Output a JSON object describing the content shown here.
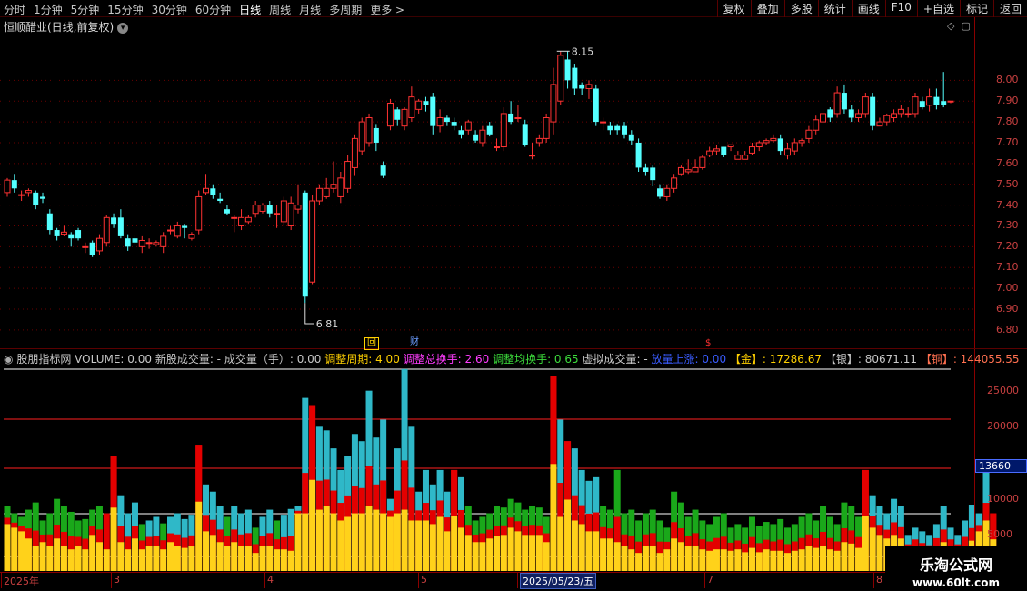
{
  "toolbar": {
    "periods": [
      "分时",
      "1分钟",
      "5分钟",
      "15分钟",
      "30分钟",
      "60分钟",
      "日线",
      "周线",
      "月线",
      "多周期",
      "更多 >"
    ],
    "active": "日线",
    "right": [
      "复权",
      "叠加",
      "多股",
      "统计",
      "画线",
      "F10",
      "+自选",
      "标记",
      "返回"
    ]
  },
  "title": "恒顺醋业(日线,前复权)",
  "price_axis": [
    "8.00",
    "7.90",
    "7.80",
    "7.70",
    "7.60",
    "7.50",
    "7.40",
    "7.30",
    "7.20",
    "7.10",
    "7.00",
    "6.90",
    "6.80"
  ],
  "high_label": "8.15",
  "low_label": "6.81",
  "events": {
    "hui": "回",
    "cai": "财",
    "dollar": "$"
  },
  "indicator": {
    "name": "股朋指标网",
    "volume": "VOLUME: 0.00",
    "new_vol": "新股成交量: -",
    "vol_hand": "成交量（手）: 0.00",
    "period": "调整周期: 4.00",
    "total_turn": "调整总换手: 2.60",
    "avg_turn": "调整均换手: 0.65",
    "virt": "虚拟成交量: -",
    "up": "放量上涨: 0.00",
    "gold": "【金】: 17286.67",
    "silver": "【银】: 80671.11",
    "copper": "【铜】: 144055.55"
  },
  "vol_axis": [
    "25000",
    "20000",
    "10000",
    "5000"
  ],
  "vol_highlight": "13660",
  "dates": [
    "2025年",
    "3",
    "4",
    "5",
    "2025/05/23/五",
    "7",
    "8"
  ],
  "watermark": {
    "line1": "乐淘公式网",
    "line2": "www.60lt.com"
  },
  "chart_data": {
    "type": "candlestick",
    "ylim": [
      6.76,
      8.22
    ],
    "candles": [
      [
        7.46,
        7.52,
        7.44,
        7.53
      ],
      [
        7.52,
        7.48,
        7.46,
        7.55
      ],
      [
        7.45,
        7.45,
        7.42,
        7.47
      ],
      [
        7.46,
        7.47,
        7.44,
        7.48
      ],
      [
        7.46,
        7.4,
        7.38,
        7.47
      ],
      [
        7.44,
        7.43,
        7.41,
        7.46
      ],
      [
        7.36,
        7.28,
        7.26,
        7.38
      ],
      [
        7.28,
        7.25,
        7.23,
        7.29
      ],
      [
        7.26,
        7.27,
        7.25,
        7.3
      ],
      [
        7.26,
        7.24,
        7.2,
        7.27
      ],
      [
        7.28,
        7.24,
        7.23,
        7.29
      ],
      [
        7.2,
        7.2,
        7.17,
        7.22
      ],
      [
        7.22,
        7.16,
        7.15,
        7.23
      ],
      [
        7.18,
        7.24,
        7.16,
        7.26
      ],
      [
        7.22,
        7.34,
        7.2,
        7.35
      ],
      [
        7.34,
        7.31,
        7.29,
        7.36
      ],
      [
        7.34,
        7.25,
        7.24,
        7.38
      ],
      [
        7.24,
        7.2,
        7.18,
        7.26
      ],
      [
        7.24,
        7.22,
        7.21,
        7.26
      ],
      [
        7.2,
        7.23,
        7.17,
        7.25
      ],
      [
        7.22,
        7.22,
        7.19,
        7.24
      ],
      [
        7.21,
        7.22,
        7.2,
        7.23
      ],
      [
        7.2,
        7.25,
        7.17,
        7.27
      ],
      [
        7.28,
        7.28,
        7.26,
        7.3
      ],
      [
        7.25,
        7.3,
        7.24,
        7.32
      ],
      [
        7.3,
        7.29,
        7.24,
        7.31
      ],
      [
        7.24,
        7.26,
        7.23,
        7.27
      ],
      [
        7.28,
        7.44,
        7.26,
        7.47
      ],
      [
        7.46,
        7.48,
        7.45,
        7.55
      ],
      [
        7.48,
        7.45,
        7.43,
        7.5
      ],
      [
        7.43,
        7.42,
        7.41,
        7.46
      ],
      [
        7.38,
        7.36,
        7.35,
        7.4
      ],
      [
        7.34,
        7.34,
        7.27,
        7.35
      ],
      [
        7.3,
        7.34,
        7.28,
        7.38
      ],
      [
        7.32,
        7.34,
        7.31,
        7.35
      ],
      [
        7.36,
        7.4,
        7.34,
        7.42
      ],
      [
        7.37,
        7.4,
        7.36,
        7.41
      ],
      [
        7.4,
        7.36,
        7.34,
        7.42
      ],
      [
        7.36,
        7.36,
        7.29,
        7.4
      ],
      [
        7.32,
        7.42,
        7.3,
        7.44
      ],
      [
        7.3,
        7.41,
        7.28,
        7.44
      ],
      [
        7.38,
        7.4,
        7.36,
        7.5
      ],
      [
        7.46,
        6.96,
        6.93,
        7.47
      ],
      [
        7.03,
        7.42,
        7.02,
        7.45
      ],
      [
        7.42,
        7.48,
        7.4,
        7.5
      ],
      [
        7.44,
        7.48,
        7.43,
        7.53
      ],
      [
        7.48,
        7.5,
        7.46,
        7.61
      ],
      [
        7.44,
        7.53,
        7.41,
        7.56
      ],
      [
        7.48,
        7.61,
        7.46,
        7.64
      ],
      [
        7.58,
        7.72,
        7.54,
        7.74
      ],
      [
        7.66,
        7.8,
        7.64,
        7.82
      ],
      [
        7.7,
        7.82,
        7.68,
        7.84
      ],
      [
        7.77,
        7.7,
        7.66,
        7.79
      ],
      [
        7.59,
        7.54,
        7.53,
        7.61
      ],
      [
        7.78,
        7.89,
        7.76,
        7.91
      ],
      [
        7.86,
        7.81,
        7.78,
        7.87
      ],
      [
        7.78,
        7.86,
        7.76,
        7.87
      ],
      [
        7.82,
        7.92,
        7.8,
        7.97
      ],
      [
        7.86,
        7.9,
        7.84,
        7.91
      ],
      [
        7.9,
        7.88,
        7.85,
        7.92
      ],
      [
        7.92,
        7.78,
        7.74,
        7.94
      ],
      [
        7.78,
        7.82,
        7.75,
        7.86
      ],
      [
        7.82,
        7.8,
        7.78,
        7.83
      ],
      [
        7.8,
        7.78,
        7.76,
        7.82
      ],
      [
        7.76,
        7.74,
        7.72,
        7.78
      ],
      [
        7.76,
        7.8,
        7.74,
        7.81
      ],
      [
        7.74,
        7.71,
        7.7,
        7.76
      ],
      [
        7.7,
        7.76,
        7.68,
        7.78
      ],
      [
        7.78,
        7.74,
        7.73,
        7.8
      ],
      [
        7.68,
        7.68,
        7.66,
        7.72
      ],
      [
        7.68,
        7.84,
        7.66,
        7.87
      ],
      [
        7.84,
        7.8,
        7.79,
        7.9
      ],
      [
        7.82,
        7.82,
        7.8,
        7.88
      ],
      [
        7.79,
        7.69,
        7.68,
        7.81
      ],
      [
        7.64,
        7.64,
        7.62,
        7.7
      ],
      [
        7.7,
        7.72,
        7.68,
        7.74
      ],
      [
        7.72,
        7.82,
        7.7,
        7.84
      ],
      [
        7.8,
        7.98,
        7.74,
        8.06
      ],
      [
        7.9,
        8.12,
        7.88,
        8.14
      ],
      [
        8.1,
        8.0,
        7.96,
        8.14
      ],
      [
        8.06,
        7.96,
        7.93,
        8.08
      ],
      [
        7.98,
        7.96,
        7.93,
        7.99
      ],
      [
        7.96,
        7.98,
        7.91,
        8.0
      ],
      [
        7.96,
        7.8,
        7.78,
        7.98
      ],
      [
        7.8,
        7.8,
        7.76,
        7.82
      ],
      [
        7.78,
        7.76,
        7.74,
        7.8
      ],
      [
        7.78,
        7.76,
        7.74,
        7.79
      ],
      [
        7.78,
        7.74,
        7.72,
        7.8
      ],
      [
        7.74,
        7.71,
        7.69,
        7.76
      ],
      [
        7.7,
        7.58,
        7.56,
        7.72
      ],
      [
        7.58,
        7.56,
        7.54,
        7.6
      ],
      [
        7.58,
        7.52,
        7.49,
        7.59
      ],
      [
        7.48,
        7.44,
        7.43,
        7.5
      ],
      [
        7.44,
        7.48,
        7.42,
        7.5
      ],
      [
        7.48,
        7.53,
        7.46,
        7.55
      ],
      [
        7.55,
        7.58,
        7.54,
        7.59
      ],
      [
        7.56,
        7.57,
        7.55,
        7.62
      ],
      [
        7.56,
        7.58,
        7.56,
        7.62
      ],
      [
        7.58,
        7.63,
        7.57,
        7.64
      ],
      [
        7.64,
        7.66,
        7.63,
        7.68
      ],
      [
        7.66,
        7.67,
        7.64,
        7.69
      ],
      [
        7.68,
        7.64,
        7.63,
        7.68
      ],
      [
        7.68,
        7.69,
        7.66,
        7.69
      ],
      [
        7.62,
        7.64,
        7.62,
        7.66
      ],
      [
        7.62,
        7.64,
        7.62,
        7.66
      ],
      [
        7.65,
        7.68,
        7.64,
        7.7
      ],
      [
        7.68,
        7.7,
        7.66,
        7.71
      ],
      [
        7.7,
        7.71,
        7.69,
        7.72
      ],
      [
        7.71,
        7.72,
        7.7,
        7.74
      ],
      [
        7.72,
        7.66,
        7.64,
        7.74
      ],
      [
        7.64,
        7.67,
        7.62,
        7.7
      ],
      [
        7.66,
        7.7,
        7.64,
        7.72
      ],
      [
        7.7,
        7.71,
        7.68,
        7.72
      ],
      [
        7.72,
        7.76,
        7.7,
        7.78
      ],
      [
        7.76,
        7.81,
        7.74,
        7.83
      ],
      [
        7.8,
        7.84,
        7.79,
        7.86
      ],
      [
        7.86,
        7.82,
        7.8,
        7.87
      ],
      [
        7.84,
        7.94,
        7.82,
        7.97
      ],
      [
        7.94,
        7.86,
        7.84,
        7.98
      ],
      [
        7.86,
        7.82,
        7.8,
        7.88
      ],
      [
        7.82,
        7.84,
        7.8,
        7.86
      ],
      [
        7.84,
        7.92,
        7.82,
        7.94
      ],
      [
        7.92,
        7.78,
        7.76,
        7.94
      ],
      [
        7.78,
        7.8,
        7.78,
        7.82
      ],
      [
        7.8,
        7.83,
        7.78,
        7.84
      ],
      [
        7.82,
        7.84,
        7.8,
        7.86
      ],
      [
        7.84,
        7.86,
        7.82,
        7.88
      ],
      [
        7.84,
        7.84,
        7.82,
        7.87
      ],
      [
        7.84,
        7.92,
        7.82,
        7.94
      ],
      [
        7.9,
        7.87,
        7.86,
        7.92
      ],
      [
        7.88,
        7.92,
        7.85,
        7.96
      ],
      [
        7.92,
        7.88,
        7.86,
        7.96
      ],
      [
        7.9,
        7.88,
        7.87,
        8.04
      ],
      [
        7.9,
        7.9,
        7.89,
        7.9
      ]
    ],
    "volume": [
      [
        9000,
        "g",
        6500
      ],
      [
        8000,
        "g",
        6000
      ],
      [
        7500,
        "g",
        5500
      ],
      [
        8500,
        "g",
        4500
      ],
      [
        9500,
        "g",
        3500
      ],
      [
        7000,
        "g",
        4000
      ],
      [
        8000,
        "g",
        3500
      ],
      [
        10000,
        "g",
        4500
      ],
      [
        9000,
        "g",
        3500
      ],
      [
        8200,
        "g",
        3000
      ],
      [
        7000,
        "g",
        3500
      ],
      [
        7200,
        "g",
        3000
      ],
      [
        8500,
        "g",
        5000
      ],
      [
        9000,
        "g",
        4000
      ],
      [
        8000,
        "r",
        3000
      ],
      [
        16000,
        "r",
        0
      ],
      [
        10500,
        "c",
        4000
      ],
      [
        8000,
        "c",
        3000
      ],
      [
        9500,
        "c",
        4500
      ],
      [
        6500,
        "g",
        3000
      ],
      [
        7000,
        "c",
        3500
      ],
      [
        7500,
        "c",
        3500
      ],
      [
        6600,
        "g",
        3000
      ],
      [
        7500,
        "c",
        4000
      ],
      [
        8000,
        "c",
        3500
      ],
      [
        7200,
        "c",
        3200
      ],
      [
        7800,
        "c",
        3400
      ],
      [
        17500,
        "r",
        0
      ],
      [
        12000,
        "c",
        5500
      ],
      [
        11000,
        "c",
        5000
      ],
      [
        9000,
        "c",
        4000
      ],
      [
        7500,
        "g",
        3500
      ],
      [
        9000,
        "c",
        4000
      ],
      [
        8000,
        "c",
        3500
      ],
      [
        8500,
        "c",
        3500
      ],
      [
        6000,
        "g",
        2500
      ],
      [
        7500,
        "c",
        3500
      ],
      [
        8500,
        "c",
        3500
      ],
      [
        7000,
        "g",
        3000
      ],
      [
        7800,
        "c",
        3000
      ],
      [
        8600,
        "c",
        2800
      ],
      [
        9000,
        "c",
        8000
      ],
      [
        24000,
        "c",
        8000
      ],
      [
        23000,
        "r",
        0
      ],
      [
        20000,
        "c",
        8500
      ],
      [
        19500,
        "c",
        9000
      ],
      [
        17000,
        "c",
        8000
      ],
      [
        14000,
        "c",
        7000
      ],
      [
        16000,
        "c",
        7500
      ],
      [
        19000,
        "c",
        8000
      ],
      [
        18000,
        "c",
        8000
      ],
      [
        25000,
        "c",
        9000
      ],
      [
        18500,
        "c",
        8500
      ],
      [
        21000,
        "c",
        8000
      ],
      [
        10000,
        "c",
        7500
      ],
      [
        17000,
        "c",
        8000
      ],
      [
        28000,
        "c",
        8500
      ],
      [
        20000,
        "c",
        7000
      ],
      [
        11000,
        "c",
        7000
      ],
      [
        14000,
        "c",
        7000
      ],
      [
        12000,
        "c",
        6500
      ],
      [
        14000,
        "c",
        7500
      ],
      [
        11000,
        "c",
        5500
      ],
      [
        14000,
        "r",
        0
      ],
      [
        13000,
        "c",
        6000
      ],
      [
        9000,
        "g",
        5000
      ],
      [
        7000,
        "g",
        4000
      ],
      [
        7500,
        "g",
        4000
      ],
      [
        8000,
        "g",
        4500
      ],
      [
        9000,
        "g",
        4800
      ],
      [
        8800,
        "g",
        5000
      ],
      [
        10000,
        "g",
        6000
      ],
      [
        9500,
        "g",
        5500
      ],
      [
        8500,
        "g",
        5000
      ],
      [
        9000,
        "g",
        5000
      ],
      [
        8800,
        "g",
        5000
      ],
      [
        7500,
        "g",
        4000
      ],
      [
        27000,
        "r",
        0
      ],
      [
        21000,
        "c",
        7500
      ],
      [
        18000,
        "r",
        0
      ],
      [
        17000,
        "c",
        7000
      ],
      [
        14000,
        "c",
        6500
      ],
      [
        12500,
        "c",
        5500
      ],
      [
        13000,
        "c",
        5500
      ],
      [
        9000,
        "g",
        4500
      ],
      [
        8500,
        "g",
        4500
      ],
      [
        14000,
        "g",
        4000
      ],
      [
        8000,
        "g",
        3500
      ],
      [
        8500,
        "g",
        3000
      ],
      [
        7000,
        "g",
        2500
      ],
      [
        8000,
        "g",
        3500
      ],
      [
        8500,
        "g",
        3500
      ],
      [
        7000,
        "g",
        2500
      ],
      [
        6000,
        "g",
        3000
      ],
      [
        11000,
        "g",
        4500
      ],
      [
        9500,
        "g",
        4000
      ],
      [
        7500,
        "g",
        3500
      ],
      [
        8500,
        "g",
        3500
      ],
      [
        7000,
        "g",
        3000
      ],
      [
        6500,
        "g",
        2800
      ],
      [
        7500,
        "g",
        3000
      ],
      [
        8000,
        "g",
        3000
      ],
      [
        6000,
        "g",
        2800
      ],
      [
        6500,
        "g",
        3000
      ],
      [
        6000,
        "g",
        2600
      ],
      [
        7500,
        "g",
        3200
      ],
      [
        6200,
        "g",
        2600
      ],
      [
        6800,
        "g",
        3000
      ],
      [
        6500,
        "g",
        2800
      ],
      [
        7200,
        "g",
        2800
      ],
      [
        6000,
        "g",
        2500
      ],
      [
        6500,
        "g",
        2800
      ],
      [
        7500,
        "g",
        3000
      ],
      [
        8000,
        "g",
        3500
      ],
      [
        7000,
        "g",
        3200
      ],
      [
        9000,
        "g",
        3500
      ],
      [
        7500,
        "g",
        3000
      ],
      [
        6500,
        "g",
        2800
      ],
      [
        9500,
        "g",
        4000
      ],
      [
        9000,
        "g",
        3800
      ],
      [
        7500,
        "g",
        3200
      ],
      [
        14000,
        "r",
        0
      ],
      [
        10500,
        "c",
        6000
      ],
      [
        9000,
        "c",
        5000
      ],
      [
        8000,
        "c",
        4500
      ],
      [
        10000,
        "c",
        5000
      ],
      [
        9000,
        "c",
        4500
      ],
      [
        5000,
        "c",
        3000
      ],
      [
        6000,
        "c",
        3500
      ],
      [
        5500,
        "c",
        3000
      ],
      [
        5000,
        "c",
        2800
      ],
      [
        6500,
        "c",
        3500
      ],
      [
        9000,
        "c",
        4000
      ],
      [
        6000,
        "c",
        3500
      ],
      [
        5000,
        "c",
        3000
      ],
      [
        7000,
        "c",
        3500
      ],
      [
        9200,
        "c",
        4200
      ],
      [
        8000,
        "c",
        5500
      ],
      [
        14000,
        "c",
        7000
      ],
      [
        8000,
        "r",
        0
      ]
    ]
  }
}
